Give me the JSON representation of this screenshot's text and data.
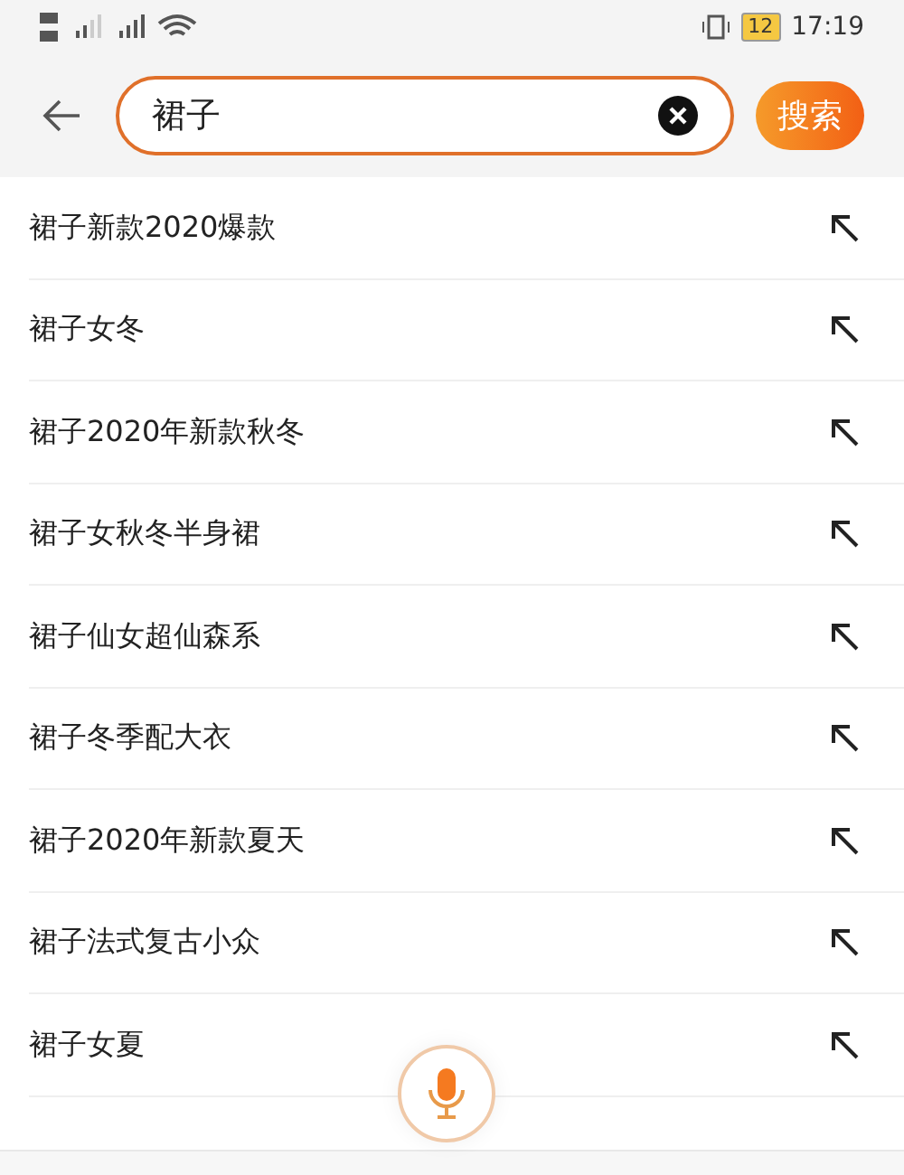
{
  "status_bar": {
    "battery": "12",
    "time": "17:19"
  },
  "search": {
    "value": "裙子",
    "button": "搜索"
  },
  "suggestions": [
    "裙子新款2020爆款",
    "裙子女冬",
    "裙子2020年新款秋冬",
    "裙子女秋冬半身裙",
    "裙子仙女超仙森系",
    "裙子冬季配大衣",
    "裙子2020年新款夏天",
    "裙子法式复古小众",
    "裙子女夏"
  ]
}
